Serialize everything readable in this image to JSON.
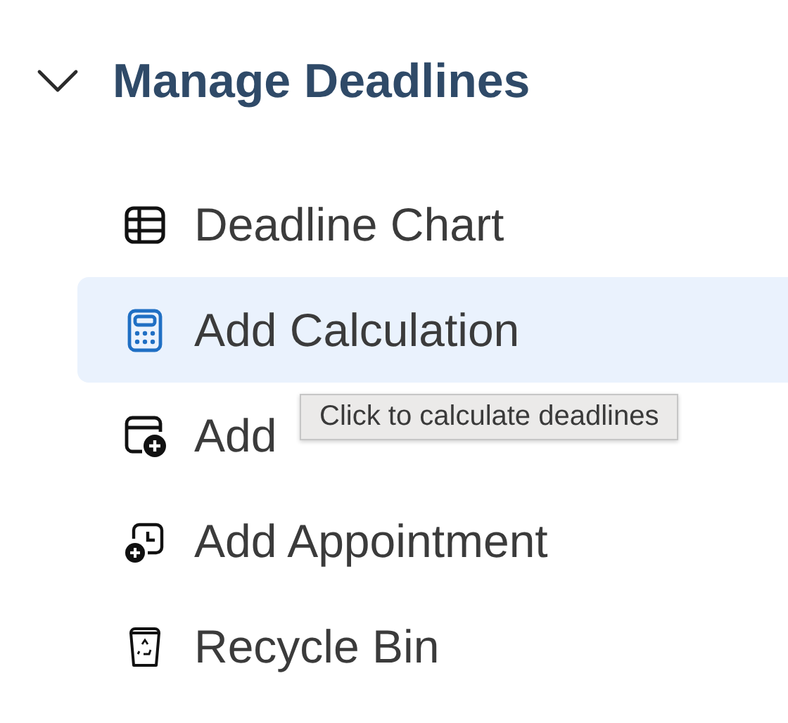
{
  "section": {
    "title": "Manage Deadlines",
    "expanded": true
  },
  "items": [
    {
      "kind": "table",
      "label": "Deadline Chart",
      "selected": false
    },
    {
      "kind": "calculator",
      "label": "Add Calculation",
      "selected": true
    },
    {
      "kind": "calendar-add",
      "label": "Add",
      "selected": false
    },
    {
      "kind": "clock-add",
      "label": "Add Appointment",
      "selected": false
    },
    {
      "kind": "trash",
      "label": "Recycle Bin",
      "selected": false
    }
  ],
  "tooltip": {
    "text": "Click to calculate deadlines"
  }
}
